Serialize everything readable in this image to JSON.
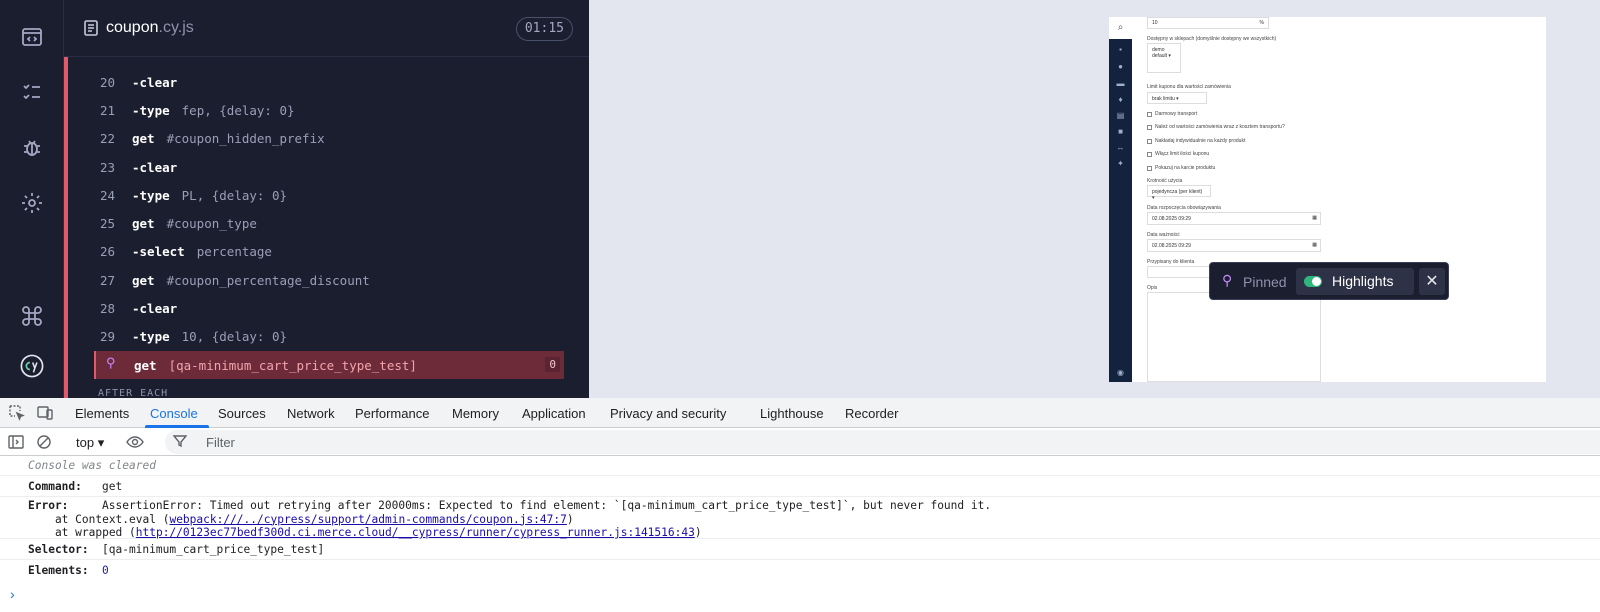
{
  "reporter": {
    "spec_name": "coupon",
    "spec_ext": ".cy.js",
    "timer": "01:15",
    "after_each": "AFTER EACH",
    "commands": [
      {
        "num": "20",
        "name": "-clear",
        "msg": ""
      },
      {
        "num": "21",
        "name": "-type",
        "msg": "fep, {delay: 0}"
      },
      {
        "num": "22",
        "name": "get",
        "msg": "#coupon_hidden_prefix"
      },
      {
        "num": "23",
        "name": "-clear",
        "msg": ""
      },
      {
        "num": "24",
        "name": "-type",
        "msg": "PL, {delay: 0}"
      },
      {
        "num": "25",
        "name": "get",
        "msg": "#coupon_type"
      },
      {
        "num": "26",
        "name": "-select",
        "msg": "percentage"
      },
      {
        "num": "27",
        "name": "get",
        "msg": "#coupon_percentage_discount"
      },
      {
        "num": "28",
        "name": "-clear",
        "msg": ""
      },
      {
        "num": "29",
        "name": "-type",
        "msg": "10, {delay: 0}"
      }
    ],
    "active_command": {
      "name": "get",
      "msg": "[qa-minimum_cart_price_type_test]",
      "count": "0"
    }
  },
  "aut": {
    "percent_value": "10",
    "percent_unit": "%",
    "channels_label": "Dostępny w sklepach (domyślnie dostępny we wszystkich)",
    "channel_1": "demo",
    "channel_2": "default",
    "limit_label": "Limit kuponu dla wartości zamówienia",
    "limit_value": "brak limitu",
    "cb_1": "Darmowy transport",
    "cb_2": "Należ od wartości zamówienia wraz z kosztem transportu?",
    "cb_3": "Nakładaj indywidualnie na każdy produkt",
    "cb_4": "Włącz limit ilości kuponu",
    "cb_5": "Pokazuj na karcie produktu",
    "usage_label": "Krotność użycia",
    "usage_value": "pojedyncza (per klient)",
    "start_label": "Data rozpoczęcia obowiązywania",
    "start_value": "02.08.2025 09:29",
    "end_label": "Data ważności",
    "end_value": "02.08.2025 09:29",
    "client_label": "Przypisany do klienta",
    "desc_label": "Opis"
  },
  "pinbar": {
    "pinned": "Pinned",
    "highlights": "Highlights"
  },
  "devtools": {
    "tabs": [
      "Elements",
      "Console",
      "Sources",
      "Network",
      "Performance",
      "Memory",
      "Application",
      "Privacy and security",
      "Lighthouse",
      "Recorder"
    ],
    "context": "top",
    "filter": "Filter",
    "cleared": "Console was cleared",
    "command_key": "Command:",
    "command_val": "get",
    "error_key": "Error:",
    "error_line1": "AssertionError: Timed out retrying after 20000ms: Expected to find element: `[qa-minimum_cart_price_type_test]`, but never found it.",
    "error_line2_pre": "    at Context.eval (",
    "error_line2_link": "webpack:///../cypress/support/admin-commands/coupon.js:47:7",
    "error_line2_post": ")",
    "error_line3_pre": "    at wrapped (",
    "error_line3_link": "http://0123ec77bedf300d.ci.merce.cloud/__cypress/runner/cypress_runner.js:141516:43",
    "error_line3_post": ")",
    "selector_key": "Selector:",
    "selector_val": "[qa-minimum_cart_price_type_test]",
    "elements_key": "Elements:",
    "elements_val": "0",
    "prompt": "›"
  }
}
